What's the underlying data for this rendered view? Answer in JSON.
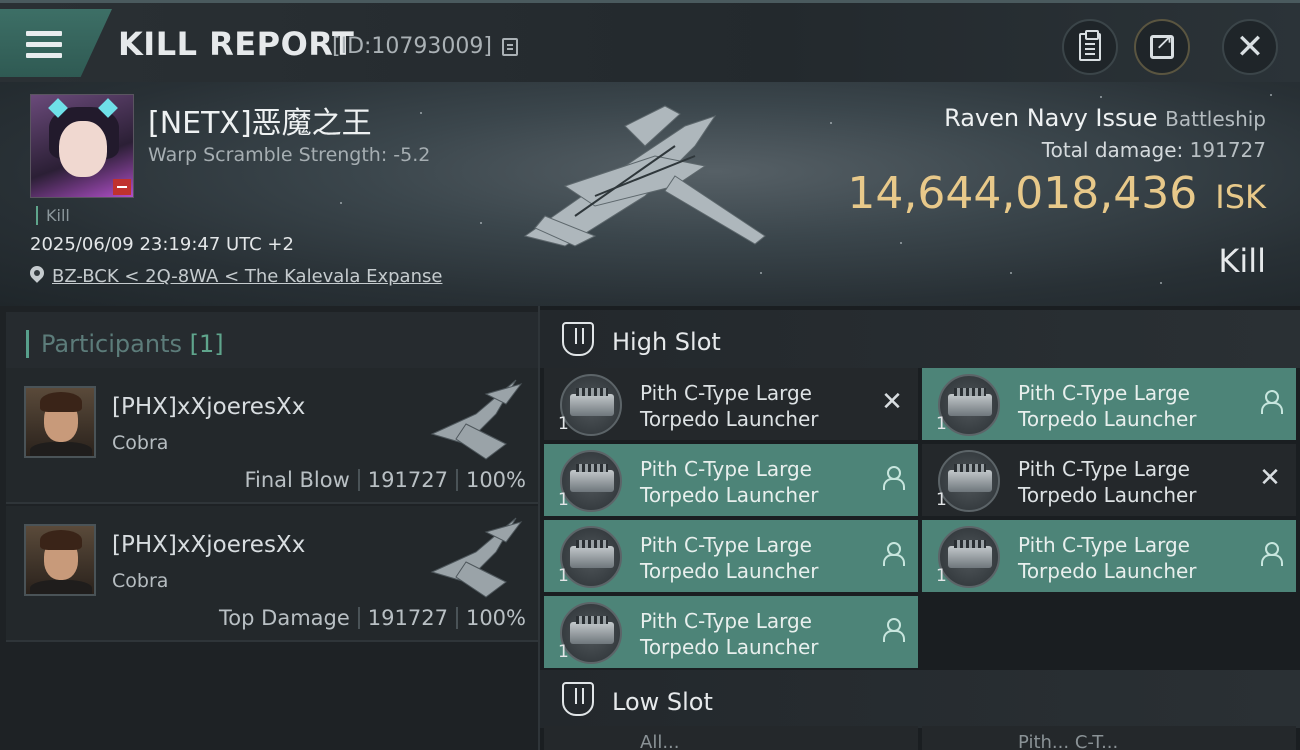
{
  "header": {
    "title": "KILL REPORT",
    "report_id": "[ID:10793009]"
  },
  "victim": {
    "name": "[NETX]恶魔之王",
    "warp_scramble": "Warp Scramble Strength: -5.2",
    "kill_tag": "Kill",
    "datetime": "2025/06/09 23:19:47 UTC +2",
    "location": "BZ-BCK < 2Q-8WA < The Kalevala Expanse"
  },
  "ship": {
    "name": "Raven Navy Issue",
    "class": "Battleship",
    "total_damage_label": "Total damage:",
    "total_damage": "191727",
    "isk_value": "14,644,018,436",
    "isk_unit": "ISK",
    "result": "Kill"
  },
  "participants": {
    "label": "Participants",
    "count": "[1]",
    "rows": [
      {
        "name": "[PHX]xXjoeresXx",
        "ship": "Cobra",
        "role": "Final Blow",
        "damage": "191727",
        "percent": "100%"
      },
      {
        "name": "[PHX]xXjoeresXx",
        "ship": "Cobra",
        "role": "Top Damage",
        "damage": "191727",
        "percent": "100%"
      }
    ]
  },
  "slots": {
    "high_label": "High Slot",
    "low_label": "Low Slot",
    "high_items": [
      {
        "line1": "Pith C-Type Large",
        "line2": "Torpedo Launcher",
        "qty": "1",
        "state": "destroyed"
      },
      {
        "line1": "Pith C-Type Large",
        "line2": "Torpedo Launcher",
        "qty": "1",
        "state": "dropped"
      },
      {
        "line1": "Pith C-Type Large",
        "line2": "Torpedo Launcher",
        "qty": "1",
        "state": "dropped"
      },
      {
        "line1": "Pith C-Type Large",
        "line2": "Torpedo Launcher",
        "qty": "1",
        "state": "destroyed"
      },
      {
        "line1": "Pith C-Type Large",
        "line2": "Torpedo Launcher",
        "qty": "1",
        "state": "dropped"
      },
      {
        "line1": "Pith C-Type Large",
        "line2": "Torpedo Launcher",
        "qty": "1",
        "state": "dropped"
      },
      {
        "line1": "Pith C-Type Large",
        "line2": "Torpedo Launcher",
        "qty": "1",
        "state": "dropped"
      }
    ],
    "low_peek": [
      "All...",
      "Pith... C-T..."
    ]
  },
  "colors": {
    "accent_teal": "#4d8478",
    "isk_gold": "#e8c98a",
    "background": "#1c2023"
  },
  "icons": {
    "menu": "menu-icon",
    "copy": "copy-icon",
    "clipboard": "clipboard-icon",
    "share": "share-icon",
    "close": "close-icon",
    "location": "location-pin-icon",
    "slot": "shield-slot-icon",
    "destroyed": "x-icon",
    "dropped": "person-icon"
  }
}
